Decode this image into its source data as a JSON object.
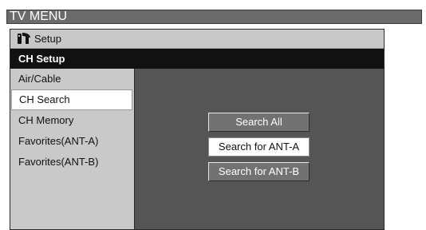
{
  "app": {
    "title": "TV MENU"
  },
  "header": {
    "section": "Setup",
    "icon": "setup-tools-icon"
  },
  "subheader": {
    "title": "CH Setup"
  },
  "menu": {
    "items": [
      {
        "label": "Air/Cable"
      },
      {
        "label": "CH Search",
        "selected": true
      },
      {
        "label": "CH Memory"
      },
      {
        "label": "Favorites(ANT-A)"
      },
      {
        "label": "Favorites(ANT-B)"
      }
    ]
  },
  "options": {
    "items": [
      {
        "label": "Search All"
      },
      {
        "label": "Search for ANT-A",
        "highlighted": true
      },
      {
        "label": "Search for ANT-B"
      }
    ]
  },
  "colors": {
    "title_bar": "#6b6b6b",
    "header_bar": "#111111",
    "menu_bg": "#c9c9c9",
    "content_bg": "#555555",
    "button_bg": "#727272",
    "highlight": "#ffffff"
  }
}
